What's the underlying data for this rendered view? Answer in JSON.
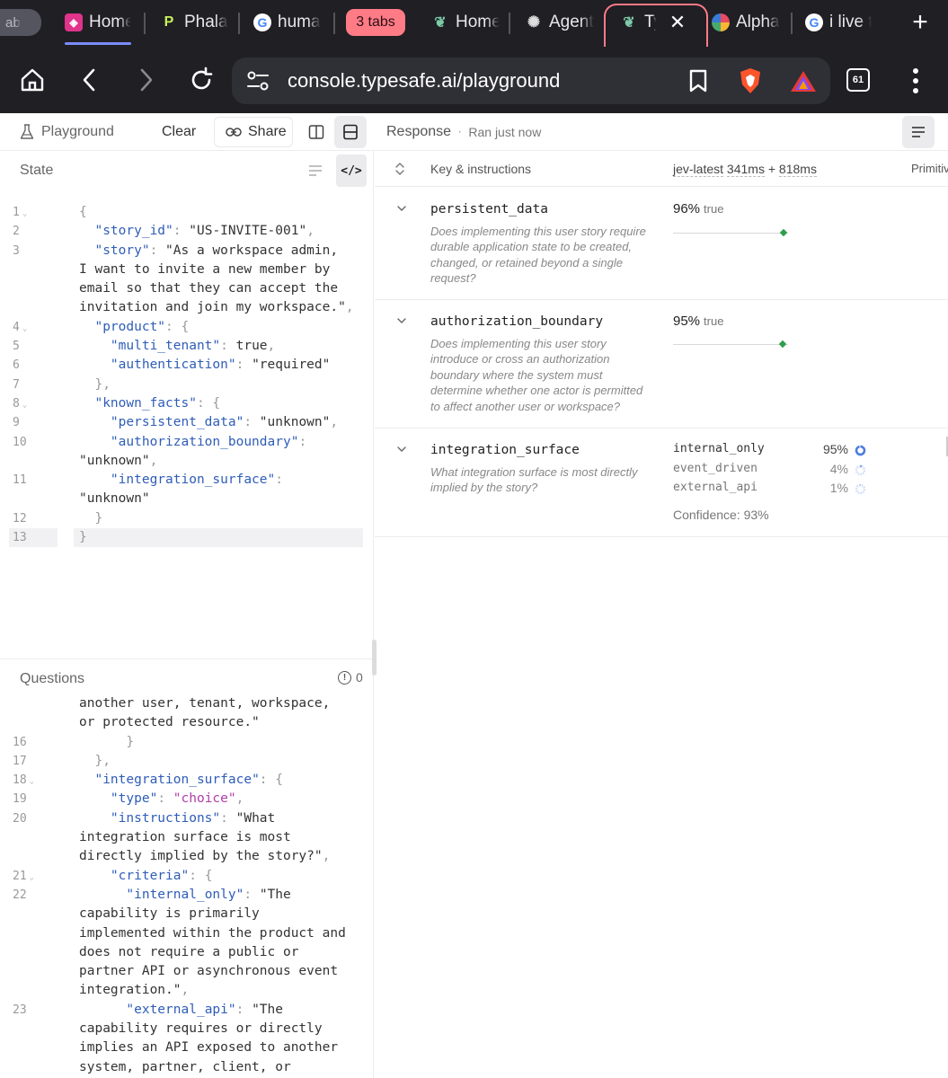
{
  "browser": {
    "tabs": {
      "first": "ab",
      "home1": "Home",
      "phala": "Phala",
      "huma": "huma",
      "group": "3 tabs",
      "home2": "Home",
      "agent": "Agent",
      "active": "Ty",
      "alpha": "Alpha",
      "ilive": "i live t"
    },
    "url": "console.typesafe.ai/playground",
    "tab_count": "61"
  },
  "toolbar": {
    "playground": "Playground",
    "clear": "Clear",
    "share": "Share",
    "response": "Response",
    "ran": "Ran just now"
  },
  "state": {
    "title": "State",
    "code_button": "</>",
    "lines": [
      {
        "n": "1",
        "fold": true
      },
      {
        "n": "2"
      },
      {
        "n": "3"
      },
      {
        "n": ""
      },
      {
        "n": ""
      },
      {
        "n": ""
      },
      {
        "n": "4",
        "fold": true
      },
      {
        "n": "5"
      },
      {
        "n": "6"
      },
      {
        "n": "7"
      },
      {
        "n": "8",
        "fold": true
      },
      {
        "n": "9"
      },
      {
        "n": "10"
      },
      {
        "n": ""
      },
      {
        "n": "11"
      },
      {
        "n": ""
      },
      {
        "n": "12"
      },
      {
        "n": "13"
      }
    ]
  },
  "questions": {
    "title": "Questions",
    "count": "0",
    "gutter": [
      "",
      "",
      "16",
      "17",
      "18",
      "19",
      "20",
      "",
      "",
      "21",
      "22",
      "",
      "",
      "",
      "",
      "",
      "23",
      "",
      "",
      ""
    ]
  },
  "response": {
    "col_key": "Key & instructions",
    "model": "jev-latest",
    "latency1": "341ms",
    "plus": "+",
    "latency2": "818ms",
    "primitive": "Primitive",
    "rows": [
      {
        "key": "persistent_data",
        "description": "Does implementing this user story require durable application state to be created, changed, or retained beyond a single request?",
        "percent": "96%",
        "value": "true",
        "confidence": 0.96
      },
      {
        "key": "authorization_boundary",
        "description": "Does implementing this user story introduce or cross an authorization boundary where the system must determine whether one actor is permitted to affect another user or workspace?",
        "percent": "95%",
        "value": "true",
        "confidence": 0.95
      },
      {
        "key": "integration_surface",
        "description": "What integration surface is most directly implied by the story?",
        "choices": [
          {
            "label": "internal_only",
            "percent": "95%",
            "level": 0.95
          },
          {
            "label": "event_driven",
            "percent": "4%",
            "level": 0.04
          },
          {
            "label": "external_api",
            "percent": "1%",
            "level": 0.01
          }
        ],
        "confidence_text": "Confidence: 93%"
      }
    ]
  },
  "colors": {
    "accent_pink": "#ff7b86",
    "key_blue": "#2f5db8",
    "enum_purple": "#b03ea8",
    "track_green": "#2e9e4e",
    "ring_blue": "#4a7de0"
  }
}
